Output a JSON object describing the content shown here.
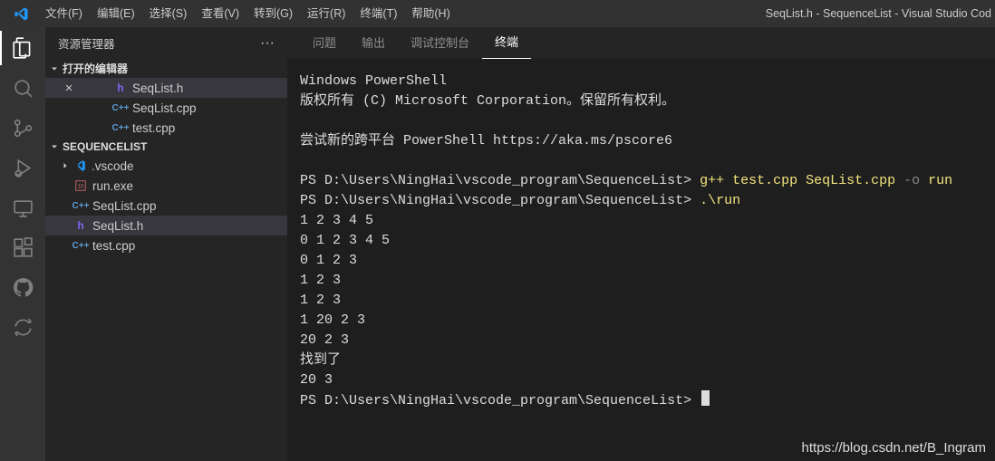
{
  "window_title": "SeqList.h - SequenceList - Visual Studio Cod",
  "menubar": [
    "文件(F)",
    "编辑(E)",
    "选择(S)",
    "查看(V)",
    "转到(G)",
    "运行(R)",
    "终端(T)",
    "帮助(H)"
  ],
  "sidebar": {
    "title": "资源管理器",
    "open_editors_label": "打开的编辑器",
    "open_editors": [
      {
        "name": "SeqList.h",
        "type": "h",
        "active": true,
        "close": true
      },
      {
        "name": "SeqList.cpp",
        "type": "cpp",
        "active": false,
        "close": false
      },
      {
        "name": "test.cpp",
        "type": "cpp",
        "active": false,
        "close": false
      }
    ],
    "workspace_label": "SEQUENCELIST",
    "workspace": [
      {
        "kind": "folder",
        "name": ".vscode",
        "icon": "vscode"
      },
      {
        "kind": "file",
        "name": "run.exe",
        "icon": "exe"
      },
      {
        "kind": "file",
        "name": "SeqList.cpp",
        "icon": "cpp"
      },
      {
        "kind": "file",
        "name": "SeqList.h",
        "icon": "h",
        "selected": true
      },
      {
        "kind": "file",
        "name": "test.cpp",
        "icon": "cpp"
      }
    ]
  },
  "panel": {
    "tabs": [
      "问题",
      "输出",
      "调试控制台",
      "终端"
    ],
    "active_tab": "终端"
  },
  "terminal": {
    "header_line1": "Windows PowerShell",
    "header_line2": "版权所有 (C) Microsoft Corporation。保留所有权利。",
    "header_line3": "尝试新的跨平台 PowerShell https://aka.ms/pscore6",
    "prompt": "PS D:\\Users\\NingHai\\vscode_program\\SequenceList>",
    "cmd1": "g++ test.cpp SeqList.cpp",
    "cmd1_gray": " -o ",
    "cmd1_tail": "run",
    "cmd2": ".\\run",
    "output": [
      "1 2 3 4 5",
      "0 1 2 3 4 5",
      "0 1 2 3",
      "1 2 3",
      "1 2 3",
      "1 20 2 3",
      "20 2 3",
      "找到了",
      "20 3"
    ]
  },
  "watermark": "https://blog.csdn.net/B_Ingram"
}
